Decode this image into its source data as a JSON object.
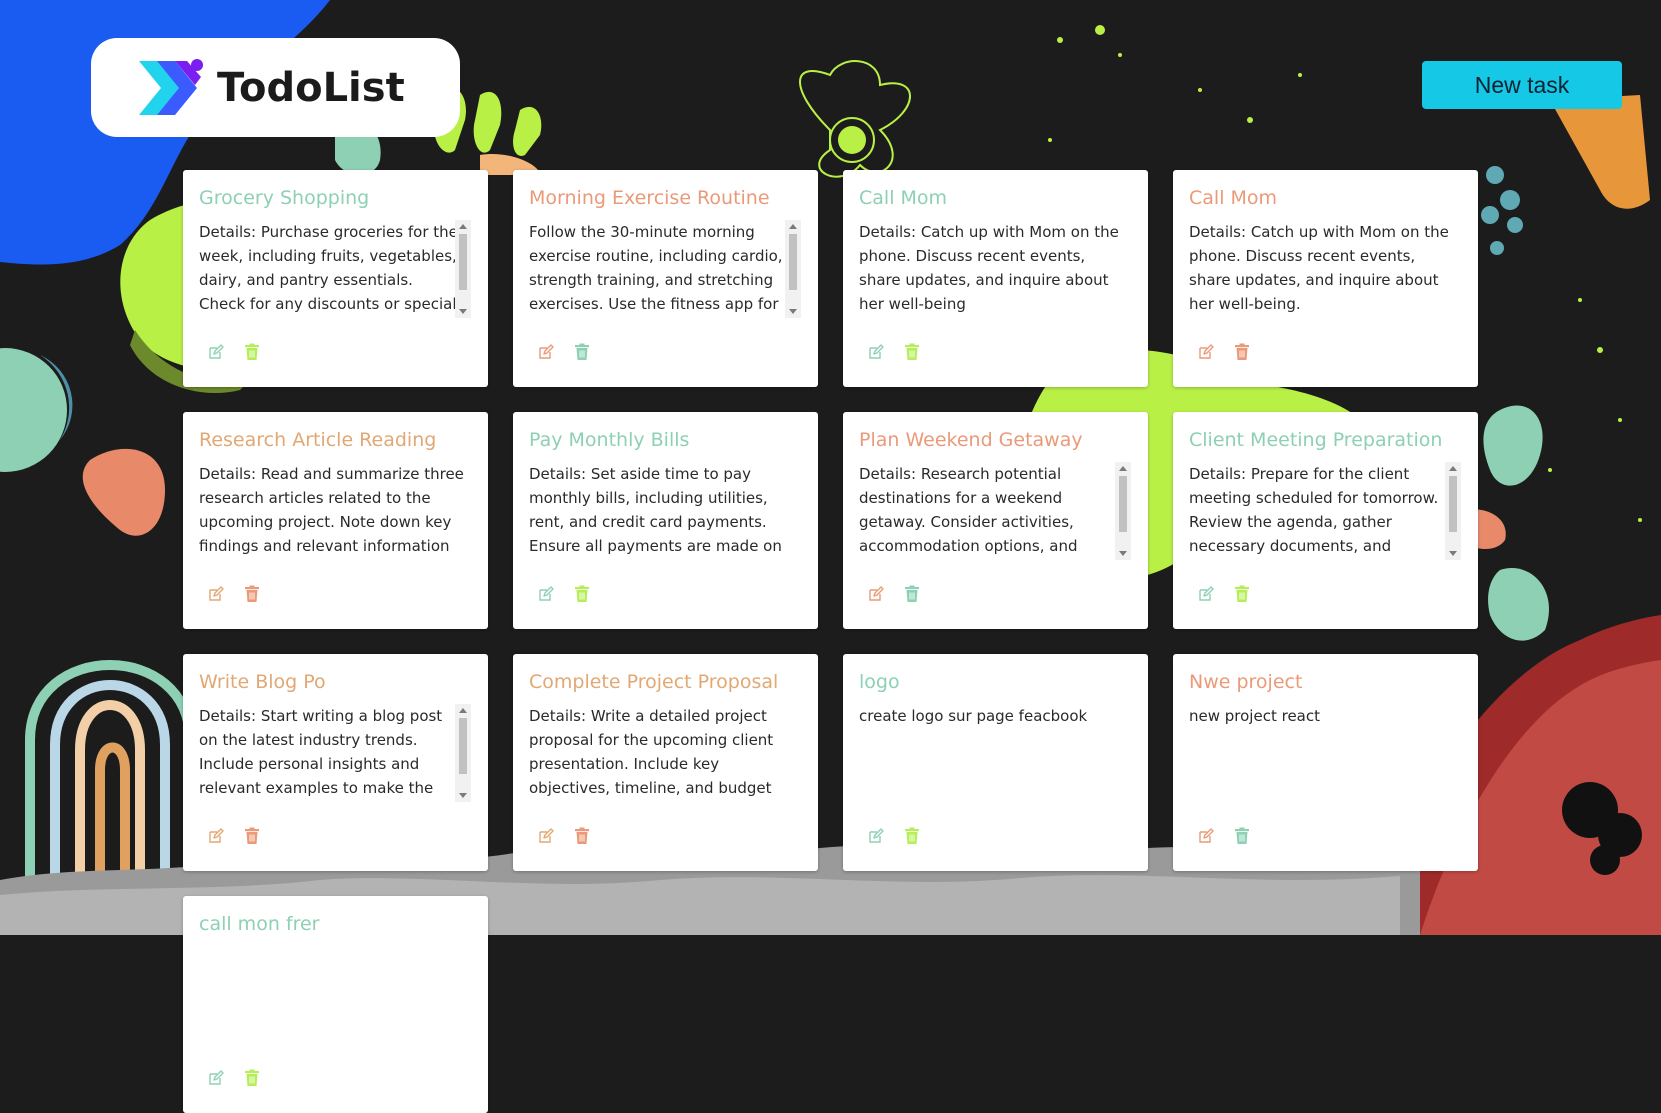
{
  "app": {
    "logo_text": "TodoList",
    "new_task_label": "New task"
  },
  "colors": {
    "background": "#1c1c1c",
    "button": "#14c8e6",
    "title_green": "#8dd0b4",
    "title_orange": "#ea9a78",
    "title_peach": "#e2a873",
    "icon_green": "#b6ee5a",
    "icon_orange": "#ea9a78",
    "icon_teal": "#8dd0b4"
  },
  "tasks": [
    {
      "title": "Grocery Shopping",
      "details": "Details: Purchase groceries for the week, including fruits, vegetables, dairy, and pantry essentials. Check for any discounts or special offers at",
      "title_color": "green",
      "edit_color": "green",
      "delete_color": "lime",
      "scroll": true
    },
    {
      "title": "Morning Exercise Routine",
      "details": "Follow the 30-minute morning exercise routine, including cardio, strength training, and stretching exercises. Use the fitness app for",
      "title_color": "orange",
      "edit_color": "orange",
      "delete_color": "green",
      "scroll": true
    },
    {
      "title": "Call Mom",
      "details": "Details: Catch up with Mom on the phone. Discuss recent events, share updates, and inquire about her well-being",
      "title_color": "green",
      "edit_color": "green",
      "delete_color": "lime",
      "scroll": false
    },
    {
      "title": "Call Mom",
      "details": "Details: Catch up with Mom on the phone. Discuss recent events, share updates, and inquire about her well-being.",
      "title_color": "orange",
      "edit_color": "orange",
      "delete_color": "orange",
      "scroll": false
    },
    {
      "title": "Research Article Reading",
      "details": "Details: Read and summarize three research articles related to the upcoming project. Note down key findings and relevant information",
      "title_color": "peach",
      "edit_color": "peach",
      "delete_color": "orange",
      "scroll": false
    },
    {
      "title": "Pay Monthly Bills",
      "details": "Details: Set aside time to pay monthly bills, including utilities, rent, and credit card payments. Ensure all payments are made on time",
      "title_color": "green",
      "edit_color": "green",
      "delete_color": "lime",
      "scroll": false
    },
    {
      "title": "Plan Weekend Getaway",
      "details": "Details: Research potential destinations for a weekend getaway. Consider activities, accommodation options, and travel",
      "title_color": "orange",
      "edit_color": "orange",
      "delete_color": "green",
      "scroll": true
    },
    {
      "title": "Client Meeting Preparation",
      "details": "Details: Prepare for the client meeting scheduled for tomorrow. Review the agenda, gather necessary documents, and rehearse",
      "title_color": "green",
      "edit_color": "green",
      "delete_color": "lime",
      "scroll": true
    },
    {
      "title": "Write Blog Po",
      "details": "Details: Start writing a blog post on the latest industry trends. Include personal insights and relevant examples to make the content",
      "title_color": "peach",
      "edit_color": "peach",
      "delete_color": "orange",
      "scroll": true
    },
    {
      "title": "Complete Project Proposal",
      "details": "Details: Write a detailed project proposal for the upcoming client presentation. Include key objectives, timeline, and budget estimate",
      "title_color": "peach",
      "edit_color": "peach",
      "delete_color": "orange",
      "scroll": false
    },
    {
      "title": "logo",
      "details": "create logo sur page feacbook",
      "title_color": "green",
      "edit_color": "green",
      "delete_color": "lime",
      "scroll": false
    },
    {
      "title": "Nwe project",
      "details": "new project react",
      "title_color": "orange",
      "edit_color": "orange",
      "delete_color": "green",
      "scroll": false
    },
    {
      "title": "call mon frer",
      "details": "",
      "title_color": "green",
      "edit_color": "green",
      "delete_color": "lime",
      "scroll": false
    }
  ]
}
